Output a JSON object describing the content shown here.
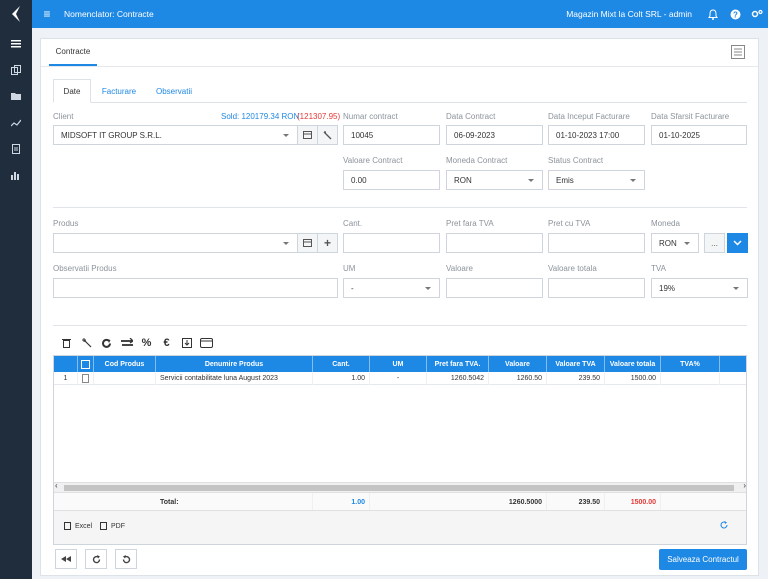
{
  "topbar": {
    "title": "Nomenclator: Contracte",
    "user": "Magazin Mixt la Colt SRL - admin"
  },
  "main_tab": "Contracte",
  "sub_tabs": [
    "Date",
    "Facturare",
    "Observatii"
  ],
  "form": {
    "client": {
      "label": "Client",
      "sold_label": "Sold: 120179.34 RON",
      "sold_extra": "(121307.95)",
      "value": "MIDSOFT IT GROUP S.R.L."
    },
    "numar_contract": {
      "label": "Numar contract",
      "value": "10045"
    },
    "data_contract": {
      "label": "Data Contract",
      "value": "06-09-2023"
    },
    "data_inceput": {
      "label": "Data Inceput Facturare",
      "value": "01-10-2023 17:00"
    },
    "data_sfarsit": {
      "label": "Data Sfarsit Facturare",
      "value": "01-10-2025"
    },
    "valoare_contract": {
      "label": "Valoare Contract",
      "value": "0.00"
    },
    "moneda_contract": {
      "label": "Moneda Contract",
      "value": "RON"
    },
    "status_contract": {
      "label": "Status Contract",
      "value": "Emis"
    }
  },
  "produs": {
    "produs_label": "Produs",
    "cant_label": "Cant.",
    "pret_fara_label": "Pret fara TVA",
    "pret_cu_label": "Pret cu TVA",
    "moneda_label": "Moneda",
    "moneda_value": "RON",
    "more_label": "...",
    "observatii_label": "Observatii Produs",
    "um_label": "UM",
    "um_value": "-",
    "valoare_label": "Valoare",
    "valoare_totala_label": "Valoare totala",
    "tva_label": "TVA",
    "tva_value": "19%"
  },
  "grid": {
    "columns": [
      "Cod Produs",
      "Denumire Produs",
      "Cant.",
      "UM",
      "Pret fara TVA.",
      "Valoare",
      "Valoare TVA",
      "Valoare totala",
      "TVA%"
    ],
    "row": {
      "nr": "1",
      "cod": "",
      "denumire": "Servicii contabilitate luna August 2023",
      "cant": "1.00",
      "um": "-",
      "pret": "1260.5042",
      "valoare": "1260.50",
      "valoare_tva": "239.50",
      "valoare_totala": "1500.00",
      "tva": ""
    },
    "totals": {
      "label": "Total:",
      "cant": "1.00",
      "valoare": "1260.5000",
      "valoare_tva": "239.50",
      "valoare_totala": "1500.00"
    },
    "export_excel": "Excel",
    "export_pdf": "PDF"
  },
  "save_label": "Salveaza Contractul",
  "colors": {
    "accent": "#1e88e5",
    "sidebar": "#1f2d3d",
    "sold_blue": "#1e88e5",
    "sold_red": "#e53935",
    "total_red": "#e53935"
  }
}
